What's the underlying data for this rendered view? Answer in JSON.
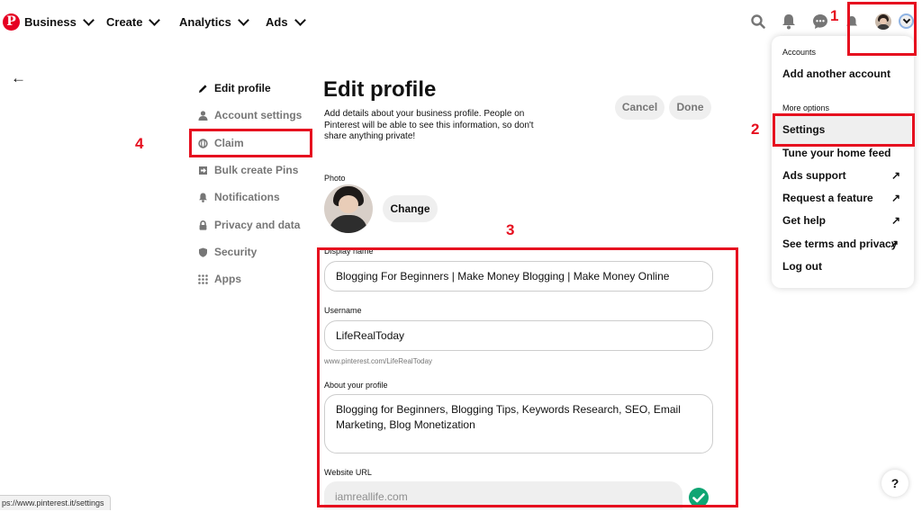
{
  "nav": {
    "logo_letter": "P",
    "business": "Business",
    "create": "Create",
    "analytics": "Analytics",
    "ads": "Ads",
    "icons": [
      "search-icon",
      "bell-icon",
      "messages-icon",
      "updates-icon",
      "avatar",
      "chevron-down-icon"
    ]
  },
  "sidebar": {
    "back_icon": "←",
    "items": [
      {
        "label": "Edit profile",
        "icon": "pencil-icon"
      },
      {
        "label": "Account settings",
        "icon": "person-icon"
      },
      {
        "label": "Claim",
        "icon": "globe-icon"
      },
      {
        "label": "Bulk create Pins",
        "icon": "import-icon"
      },
      {
        "label": "Notifications",
        "icon": "bell-icon"
      },
      {
        "label": "Privacy and data",
        "icon": "lock-icon"
      },
      {
        "label": "Security",
        "icon": "shield-icon"
      },
      {
        "label": "Apps",
        "icon": "grid-icon"
      }
    ]
  },
  "main": {
    "title": "Edit profile",
    "description": "Add details about your business profile. People on Pinterest will be able to see this information, so don't share anything private!",
    "cancel": "Cancel",
    "done": "Done",
    "photo_label": "Photo",
    "change": "Change",
    "display_name_label": "Display name",
    "display_name_value": "Blogging For Beginners | Make Money Blogging | Make Money Online",
    "username_label": "Username",
    "username_value": "LifeRealToday",
    "username_hint": "www.pinterest.com/LifeRealToday",
    "about_label": "About your profile",
    "about_value": "Blogging for Beginners, Blogging Tips, Keywords Research, SEO, Email Marketing, Blog Monetization",
    "website_label": "Website URL",
    "website_value": "iamreallife.com"
  },
  "menu": {
    "accounts_head": "Accounts",
    "add_account": "Add another account",
    "more_head": "More options",
    "settings": "Settings",
    "tune_feed": "Tune your home feed",
    "ads_support": "Ads support",
    "request_feature": "Request a feature",
    "get_help": "Get help",
    "terms": "See terms and privacy",
    "log_out": "Log out",
    "external_glyph": "↗"
  },
  "annotations": {
    "n1": "1",
    "n2": "2",
    "n3": "3",
    "n4": "4"
  },
  "status_url": "ps://www.pinterest.it/settings",
  "help": "?",
  "colors": {
    "brand": "#e60023",
    "annotation": "#e60f1f",
    "success": "#0fa573"
  }
}
